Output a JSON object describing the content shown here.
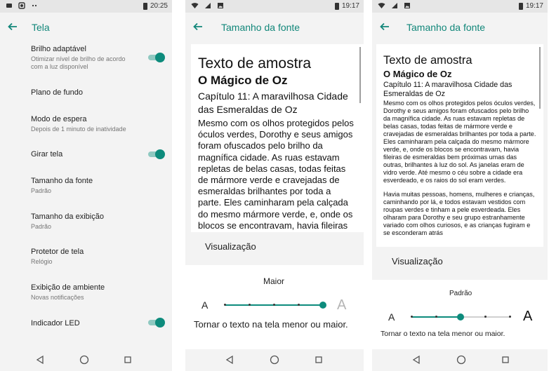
{
  "phone1": {
    "status": {
      "time": "20:25"
    },
    "title": "Tela",
    "settings": [
      {
        "title": "Brilho adaptável",
        "subtitle": "Otimizar nível de brilho de acordo com a luz disponível",
        "toggle": true
      },
      {
        "title": "Plano de fundo",
        "subtitle": "",
        "toggle": false
      },
      {
        "title": "Modo de espera",
        "subtitle": "Depois de 1 minuto de inatividade",
        "toggle": false
      },
      {
        "title": "Girar tela",
        "subtitle": "",
        "toggle": true
      },
      {
        "title": "Tamanho da fonte",
        "subtitle": "Padrão",
        "toggle": false
      },
      {
        "title": "Tamanho da exibição",
        "subtitle": "Padrão",
        "toggle": false
      },
      {
        "title": "Protetor de tela",
        "subtitle": "Relógio",
        "toggle": false
      },
      {
        "title": "Exibição de ambiente",
        "subtitle": "Novas notificações",
        "toggle": false
      },
      {
        "title": "Indicador LED",
        "subtitle": "",
        "toggle": true
      }
    ]
  },
  "phone2": {
    "status": {
      "time": "19:17"
    },
    "title": "Tamanho da fonte",
    "sample": {
      "heading": "Texto de amostra",
      "book": "O Mágico de Oz",
      "chapter": "Capítulo 11: A maravilhosa Cidade das Esmeraldas de Oz",
      "paragraph1": "Mesmo com os olhos protegidos pelos óculos verdes, Dorothy e seus amigos foram ofuscados pelo brilho da magnífica cidade. As ruas estavam repletas de belas casas, todas feitas de mármore verde e cravejadas de esmeraldas brilhantes por toda a parte. Eles caminharam pela calçada do mesmo mármore verde, e, onde os blocos se encontravam, havia fileiras de esmeraldas bem próximas"
    },
    "preview_label": "Visualização",
    "level_label": "Maior",
    "small_a": "A",
    "big_a": "A",
    "slider_level": 4,
    "description": "Tornar o texto na tela menor ou maior."
  },
  "phone3": {
    "status": {
      "time": "19:17"
    },
    "title": "Tamanho da fonte",
    "sample": {
      "heading": "Texto de amostra",
      "book": "O Mágico de Oz",
      "chapter": "Capítulo 11: A maravilhosa Cidade das Esmeraldas de Oz",
      "paragraph1": "Mesmo com os olhos protegidos pelos óculos verdes, Dorothy e seus amigos foram ofuscados pelo brilho da magnífica cidade. As ruas estavam repletas de belas casas, todas feitas de mármore verde e cravejadas de esmeraldas brilhantes por toda a parte. Eles caminharam pela calçada do mesmo mármore verde, e, onde os blocos se encontravam, havia fileiras de esmeraldas bem próximas umas das outras, brilhantes à luz do sol. As janelas eram de vidro verde. Até mesmo o céu sobre a cidade era esverdeado, e os raios do sol eram verdes.",
      "paragraph2": "Havia muitas pessoas, homens, mulheres e crianças, caminhando por lá, e todos estavam vestidos com roupas verdes e tinham a pele esverdeada. Eles olharam para Dorothy e seu grupo estranhamente variado com olhos curiosos, e as crianças fugiram e se esconderam atrás"
    },
    "preview_label": "Visualização",
    "level_label": "Padrão",
    "small_a": "A",
    "big_a": "A",
    "slider_level": 2,
    "description": "Tornar o texto na tela menor ou maior."
  },
  "colors": {
    "accent": "#0d8b7c",
    "title": "#12877a"
  },
  "icons": [
    "back-arrow-icon",
    "wifi-icon",
    "signal-icon",
    "battery-icon",
    "nav-back-icon",
    "nav-home-icon",
    "nav-recents-icon"
  ]
}
